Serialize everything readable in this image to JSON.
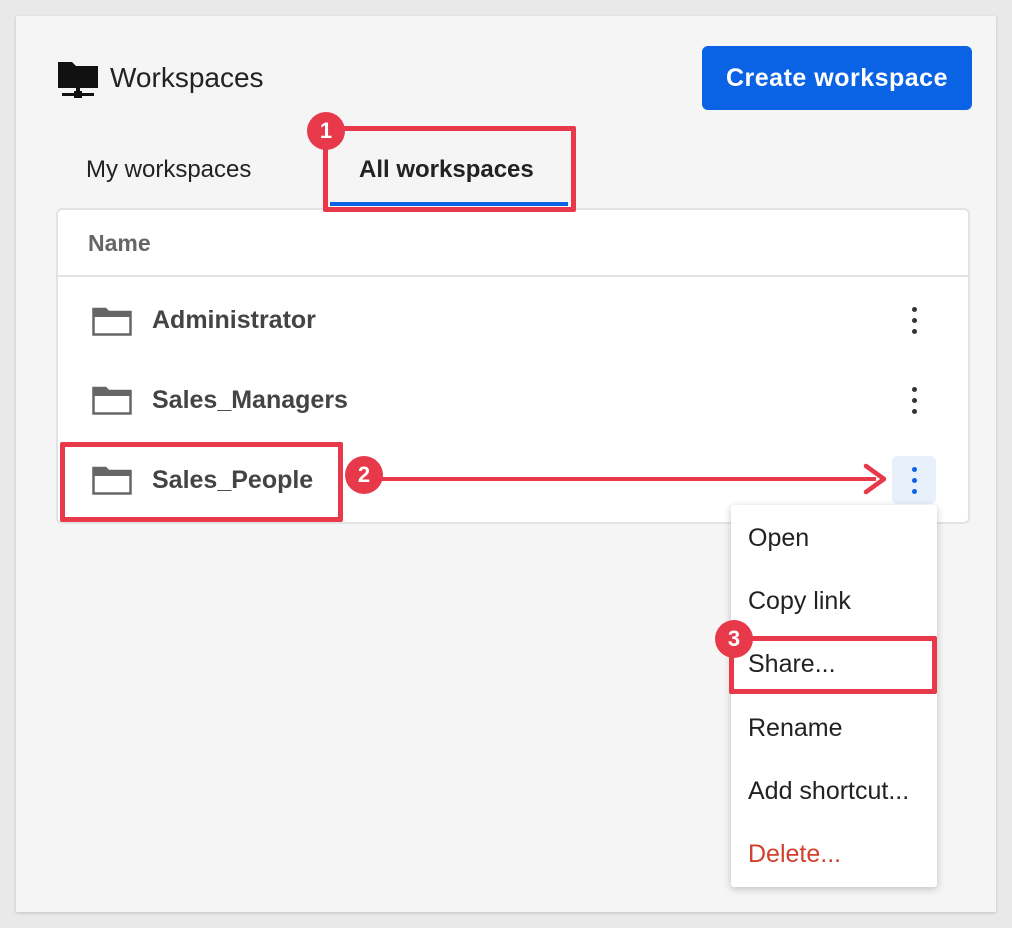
{
  "header": {
    "title": "Workspaces",
    "icon": "folder-network-icon",
    "create_label": "Create workspace"
  },
  "tabs": [
    {
      "label": "My workspaces",
      "active": false
    },
    {
      "label": "All workspaces",
      "active": true
    }
  ],
  "table": {
    "column_name": "Name",
    "rows": [
      {
        "label": "Administrator",
        "icon": "folder-icon"
      },
      {
        "label": "Sales_Managers",
        "icon": "folder-icon"
      },
      {
        "label": "Sales_People",
        "icon": "folder-icon"
      }
    ]
  },
  "context_menu": {
    "items": [
      {
        "label": "Open"
      },
      {
        "label": "Copy link"
      },
      {
        "label": "Share..."
      },
      {
        "label": "Rename"
      },
      {
        "label": "Add shortcut..."
      },
      {
        "label": "Delete..."
      }
    ]
  },
  "annotations": {
    "badges": [
      "1",
      "2",
      "3"
    ],
    "color": "#e8394b"
  },
  "colors": {
    "accent": "#0a63e5",
    "danger": "#d0402c"
  }
}
